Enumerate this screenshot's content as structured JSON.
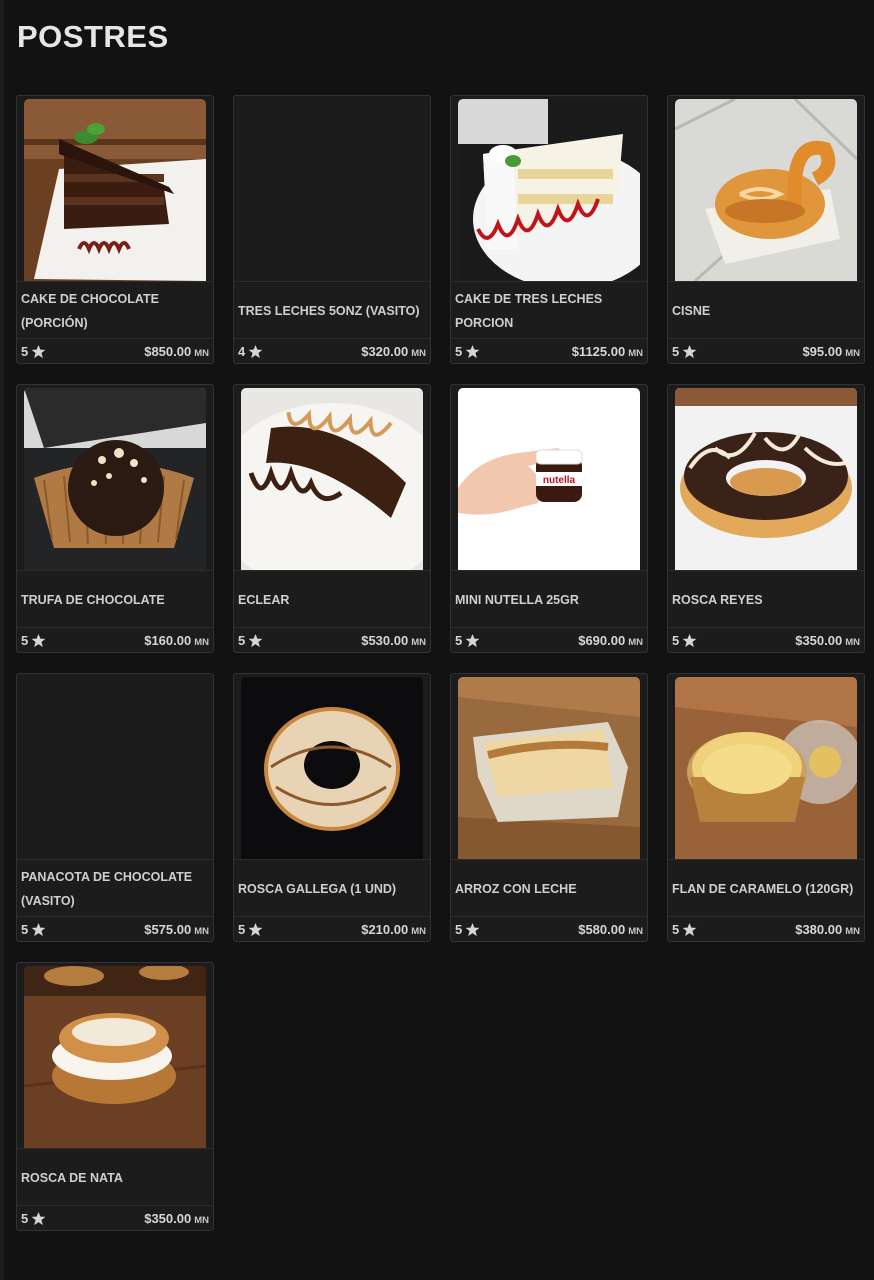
{
  "section": {
    "title": "POSTRES"
  },
  "products": [
    {
      "name": "CAKE DE CHOCOLATE (PORCIÓN)",
      "rating": "5",
      "price": "$850.00",
      "currency": "MN",
      "image": "chocolate-cake"
    },
    {
      "name": "TRES LECHES 5ONZ (VASITO)",
      "rating": "4",
      "price": "$320.00",
      "currency": "MN",
      "image": "none"
    },
    {
      "name": "CAKE DE TRES LECHES PORCION",
      "rating": "5",
      "price": "$1125.00",
      "currency": "MN",
      "image": "tres-leches-cake"
    },
    {
      "name": "CISNE",
      "rating": "5",
      "price": "$95.00",
      "currency": "MN",
      "image": "swan-pastry"
    },
    {
      "name": "TRUFA DE CHOCOLATE",
      "rating": "5",
      "price": "$160.00",
      "currency": "MN",
      "image": "chocolate-truffle"
    },
    {
      "name": "ECLEAR",
      "rating": "5",
      "price": "$530.00",
      "currency": "MN",
      "image": "eclair"
    },
    {
      "name": "MINI NUTELLA 25GR",
      "rating": "5",
      "price": "$690.00",
      "currency": "MN",
      "image": "mini-nutella"
    },
    {
      "name": "ROSCA REYES",
      "rating": "5",
      "price": "$350.00",
      "currency": "MN",
      "image": "chocolate-donut"
    },
    {
      "name": "PANACOTA DE CHOCOLATE (VASITO)",
      "rating": "5",
      "price": "$575.00",
      "currency": "MN",
      "image": "none"
    },
    {
      "name": "ROSCA GALLEGA (1 UND)",
      "rating": "5",
      "price": "$210.00",
      "currency": "MN",
      "image": "sugar-ring"
    },
    {
      "name": "ARROZ CON LECHE",
      "rating": "5",
      "price": "$580.00",
      "currency": "MN",
      "image": "rice-pudding"
    },
    {
      "name": "FLAN DE CARAMELO (120GR)",
      "rating": "5",
      "price": "$380.00",
      "currency": "MN",
      "image": "caramel-flan"
    },
    {
      "name": "ROSCA DE NATA",
      "rating": "5",
      "price": "$350.00",
      "currency": "MN",
      "image": "cream-ring"
    }
  ],
  "colors": {
    "background": "#121212",
    "card": "#1c1c1c",
    "border": "#323232",
    "text": "#cfcfcf"
  }
}
